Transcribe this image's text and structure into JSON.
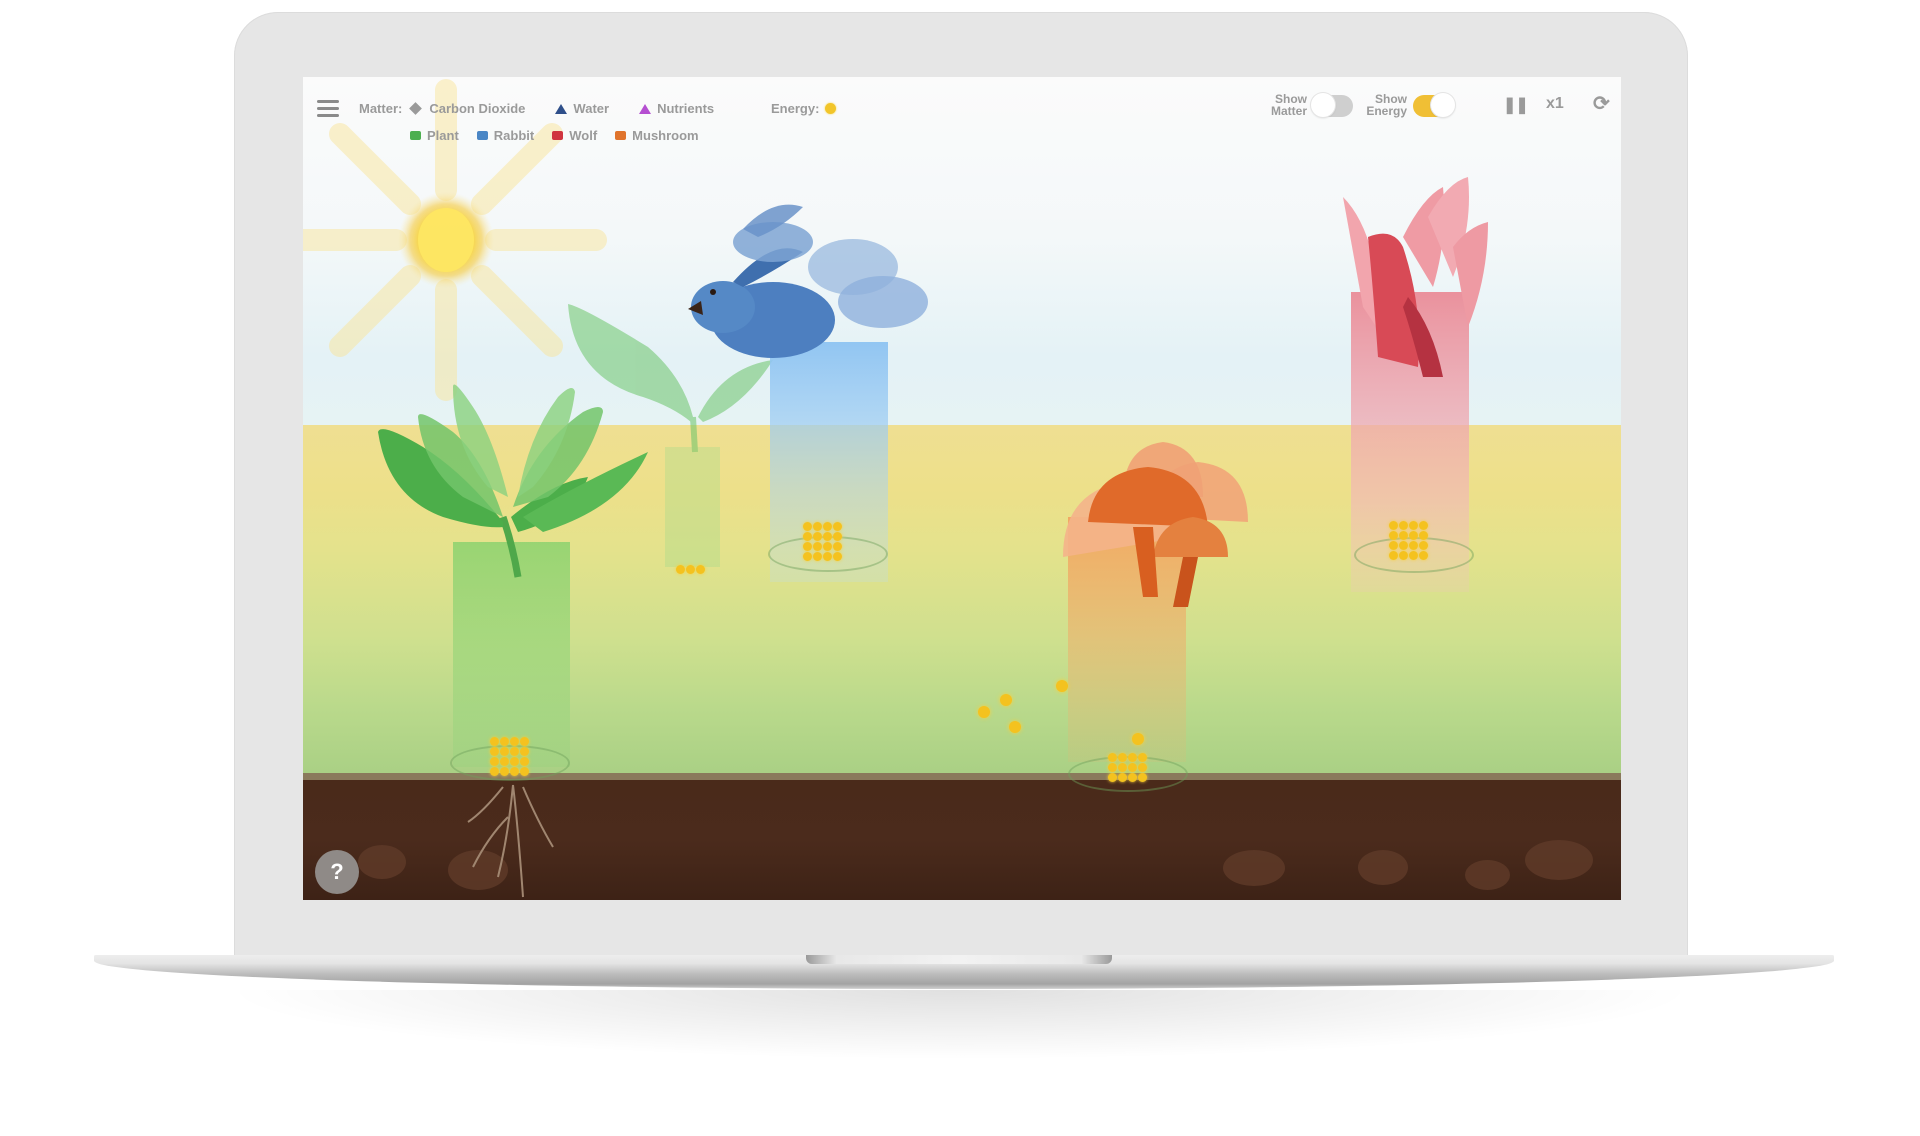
{
  "legend": {
    "matter_label": "Matter:",
    "matter_items": [
      {
        "icon": "diamond-icon",
        "label": "Carbon Dioxide",
        "color": "#9a9a9a"
      },
      {
        "icon": "triangle-icon",
        "label": "Water",
        "color": "#2f4f8a"
      },
      {
        "icon": "triangle-icon",
        "label": "Nutrients",
        "color": "#b54fd1"
      }
    ],
    "organism_items": [
      {
        "icon": "cube-icon",
        "label": "Plant",
        "color": "#4caf50"
      },
      {
        "icon": "cube-icon",
        "label": "Rabbit",
        "color": "#4a86c5"
      },
      {
        "icon": "cube-icon",
        "label": "Wolf",
        "color": "#d0353f"
      },
      {
        "icon": "cube-icon",
        "label": "Mushroom",
        "color": "#e0742c"
      }
    ],
    "energy_label": "Energy:",
    "energy_color": "#f2c52a"
  },
  "controls": {
    "show_matter": {
      "label_line1": "Show",
      "label_line2": "Matter",
      "on": false
    },
    "show_energy": {
      "label_line1": "Show",
      "label_line2": "Energy",
      "on": true,
      "color": "#f0bf35"
    },
    "pause_icon": "pause-icon",
    "speed_label": "x1",
    "reset_icon": "reset-icon"
  },
  "scene": {
    "organisms": [
      "sun",
      "plant",
      "plant-faded",
      "rabbits",
      "mushrooms",
      "wolves"
    ],
    "help_label": "?"
  }
}
